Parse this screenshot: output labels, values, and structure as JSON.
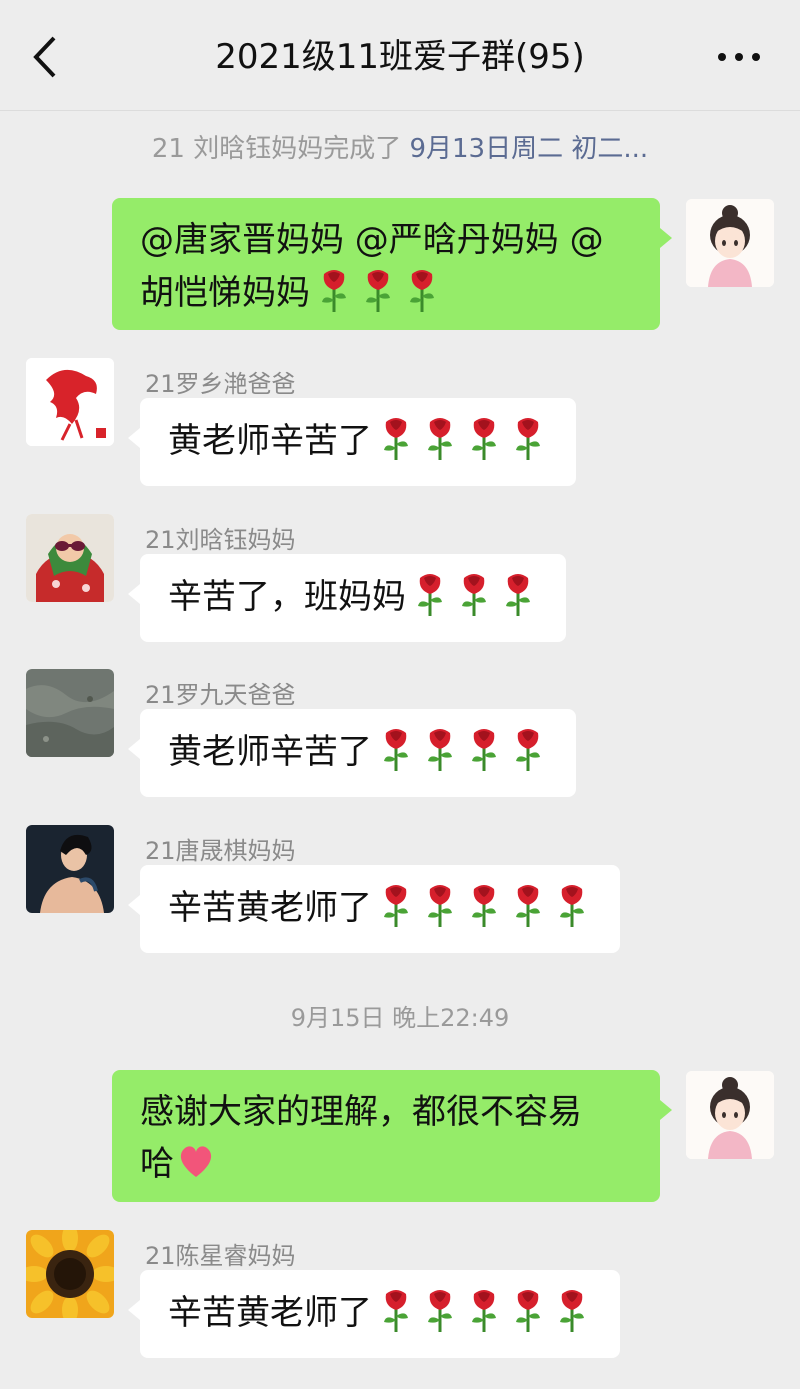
{
  "header": {
    "title": "2021级11班爱子群(95)",
    "back_icon": "chevron-left-icon",
    "more_icon": "more-icon"
  },
  "notice": {
    "prefix": "21 刘晗钰妈妈完成了",
    "highlight": "9月13日周二 初二..."
  },
  "timestamp": "9月15日 晚上22:49",
  "messages": [
    {
      "id": "m1",
      "side": "me",
      "text_line1": "@唐家晋妈妈 @严晗丹妈妈 @",
      "text_line2": "胡恺悌妈妈",
      "roses": 3
    },
    {
      "id": "m2",
      "side": "other",
      "sender": "21罗乡滟爸爸",
      "text": "黄老师辛苦了",
      "roses": 4
    },
    {
      "id": "m3",
      "side": "other",
      "sender": "21刘晗钰妈妈",
      "text": "辛苦了，班妈妈",
      "roses": 3
    },
    {
      "id": "m4",
      "side": "other",
      "sender": "21罗九天爸爸",
      "text": "黄老师辛苦了",
      "roses": 4
    },
    {
      "id": "m5",
      "side": "other",
      "sender": "21唐晟棋妈妈",
      "text": "辛苦黄老师了",
      "roses": 5
    },
    {
      "id": "m6",
      "side": "me",
      "text_line1": "感谢大家的理解，都很不容易",
      "text_line2": "哈",
      "heart": true
    },
    {
      "id": "m7",
      "side": "other",
      "sender": "21陈星睿妈妈",
      "text": "辛苦黄老师了",
      "roses": 5
    }
  ],
  "colors": {
    "background": "#ededed",
    "my_bubble": "#95ec69",
    "other_bubble": "#ffffff",
    "notice_highlight": "#5b6b92"
  }
}
